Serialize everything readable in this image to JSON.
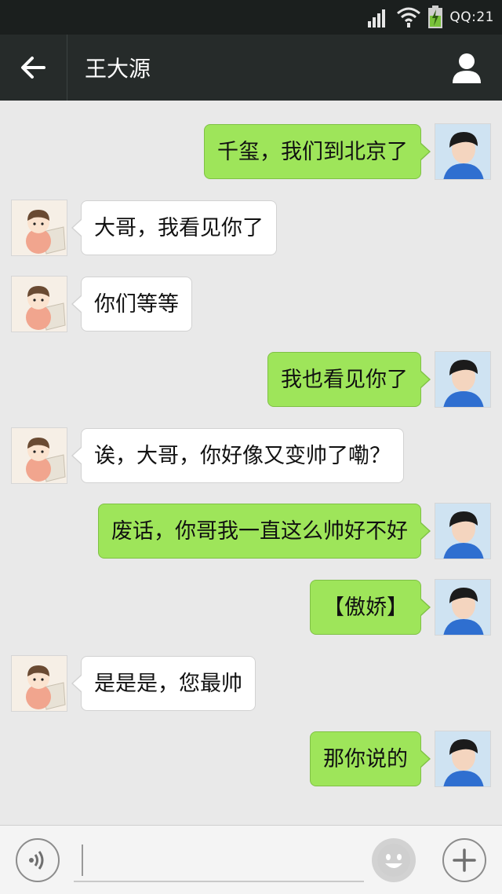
{
  "status_bar": {
    "time": "QQ:21"
  },
  "header": {
    "title": "王大源"
  },
  "messages": [
    {
      "side": "sent",
      "text": "千玺，我们到北京了"
    },
    {
      "side": "recv",
      "text": "大哥，我看见你了"
    },
    {
      "side": "recv",
      "text": "你们等等"
    },
    {
      "side": "sent",
      "text": "我也看见你了"
    },
    {
      "side": "recv",
      "text": "诶，大哥，你好像又变帅了嘞？"
    },
    {
      "side": "sent",
      "text": "废话，你哥我一直这么帅好不好"
    },
    {
      "side": "sent",
      "text": "【傲娇】"
    },
    {
      "side": "recv",
      "text": "是是是，您最帅"
    },
    {
      "side": "sent",
      "text": "那你说的"
    }
  ],
  "input": {
    "value": "",
    "placeholder": ""
  },
  "icons": {
    "back": "back-arrow-icon",
    "profile": "person-icon",
    "voice": "voice-icon",
    "emoji": "emoji-icon",
    "plus": "plus-icon"
  },
  "colors": {
    "sent_bubble": "#9ee55a",
    "recv_bubble": "#ffffff",
    "chat_background": "#e9e9e9",
    "nav_background": "#262b2a"
  }
}
